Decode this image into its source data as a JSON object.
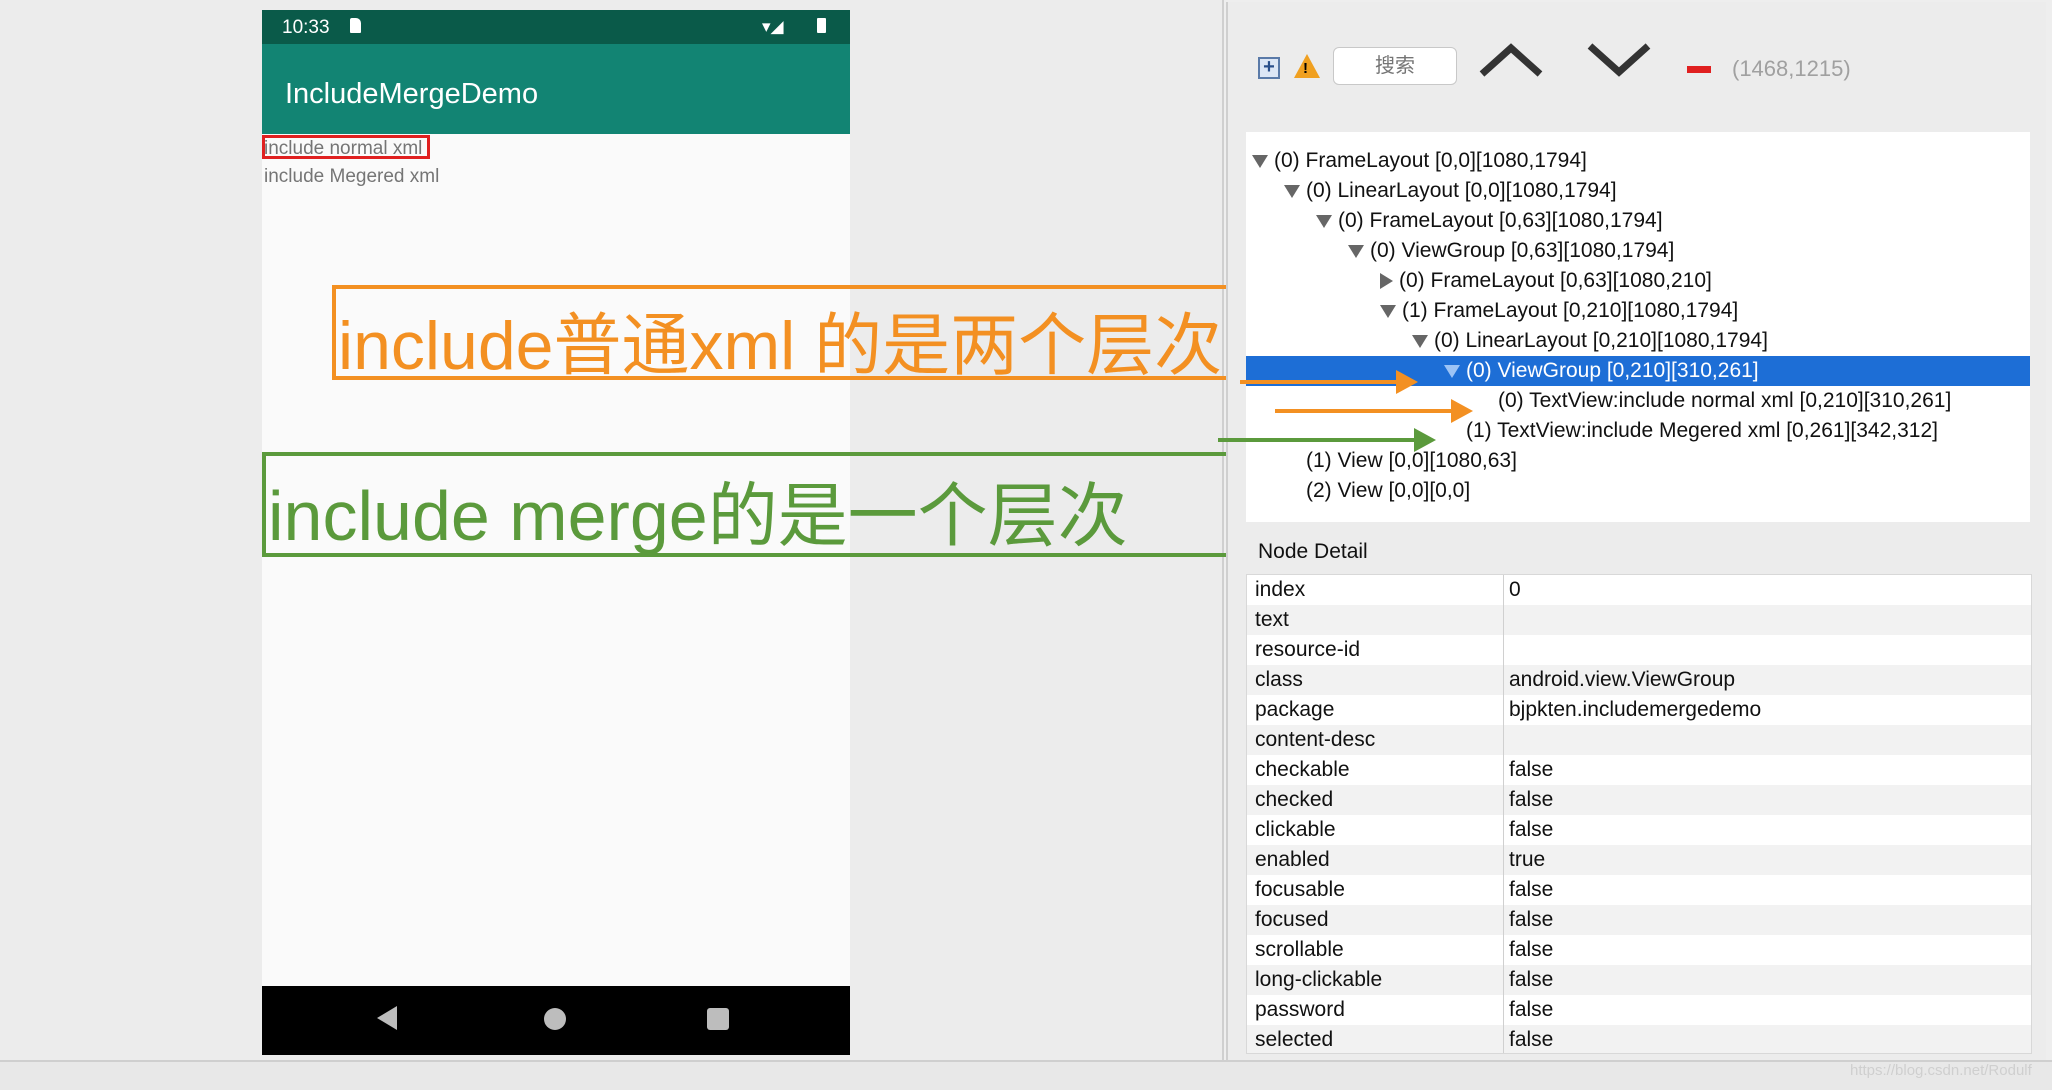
{
  "device": {
    "status_time": "10:33",
    "app_title": "IncludeMergeDemo",
    "textviews": [
      "include normal xml",
      "include Megered xml"
    ]
  },
  "annotations": {
    "orange": "include普通xml 的是两个层次",
    "green": "include merge的是一个层次"
  },
  "toolbar": {
    "search_placeholder": "搜索",
    "coords": "(1468,1215)"
  },
  "tree": [
    {
      "indent": 0,
      "toggle": "down",
      "label": "(0) FrameLayout [0,0][1080,1794]"
    },
    {
      "indent": 1,
      "toggle": "down",
      "label": "(0) LinearLayout [0,0][1080,1794]"
    },
    {
      "indent": 2,
      "toggle": "down",
      "label": "(0) FrameLayout [0,63][1080,1794]"
    },
    {
      "indent": 3,
      "toggle": "down",
      "label": "(0) ViewGroup [0,63][1080,1794]"
    },
    {
      "indent": 4,
      "toggle": "right",
      "label": "(0) FrameLayout [0,63][1080,210]"
    },
    {
      "indent": 4,
      "toggle": "down",
      "label": "(1) FrameLayout [0,210][1080,1794]"
    },
    {
      "indent": 5,
      "toggle": "down",
      "label": "(0) LinearLayout [0,210][1080,1794]"
    },
    {
      "indent": 6,
      "toggle": "down",
      "label": "(0) ViewGroup [0,210][310,261]",
      "selected": true
    },
    {
      "indent": 7,
      "toggle": "none",
      "label": "(0) TextView:include normal xml [0,210][310,261]"
    },
    {
      "indent": 6,
      "toggle": "none",
      "label": "(1) TextView:include Megered xml [0,261][342,312]"
    },
    {
      "indent": 1,
      "toggle": "none",
      "label": "(1) View [0,0][1080,63]"
    },
    {
      "indent": 1,
      "toggle": "none",
      "label": "(2) View [0,0][0,0]"
    }
  ],
  "detail": {
    "title": "Node Detail",
    "rows": [
      [
        "index",
        "0"
      ],
      [
        "text",
        ""
      ],
      [
        "resource-id",
        ""
      ],
      [
        "class",
        "android.view.ViewGroup"
      ],
      [
        "package",
        "bjpkten.includemergedemo"
      ],
      [
        "content-desc",
        ""
      ],
      [
        "checkable",
        "false"
      ],
      [
        "checked",
        "false"
      ],
      [
        "clickable",
        "false"
      ],
      [
        "enabled",
        "true"
      ],
      [
        "focusable",
        "false"
      ],
      [
        "focused",
        "false"
      ],
      [
        "scrollable",
        "false"
      ],
      [
        "long-clickable",
        "false"
      ],
      [
        "password",
        "false"
      ],
      [
        "selected",
        "false"
      ]
    ]
  },
  "watermark": "https://blog.csdn.net/Rodulf",
  "colors": {
    "orange": "#f39022",
    "green": "#5b9a3c",
    "selection": "#1d6ed6",
    "appbar": "#128473"
  }
}
